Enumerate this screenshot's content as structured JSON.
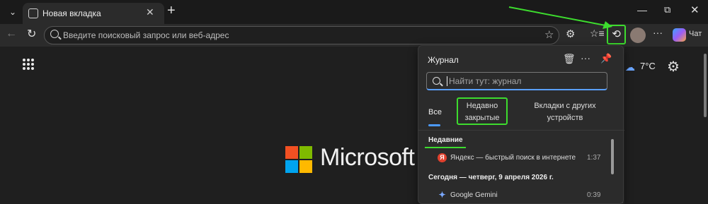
{
  "browser": {
    "tab": {
      "title": "Новая вкладка",
      "close": "✕"
    },
    "new_tab": "+",
    "window": {
      "minimize": "—",
      "maximize": "⧉",
      "close": "✕"
    },
    "tab_menu": "⌄"
  },
  "toolbar": {
    "back": "←",
    "reload": "↻",
    "omnibox_placeholder": "Введите поисковый запрос или веб-адрес",
    "star": "☆",
    "extensions": "⚙",
    "favorites": "☆≡",
    "history": "⟲",
    "more": "···",
    "chat_label": "Чат"
  },
  "page": {
    "brand_text": "Microsoft",
    "weather": {
      "icon": "☁",
      "temp": "7°C"
    },
    "settings": "⚙"
  },
  "history_panel": {
    "title": "Журнал",
    "trash": "🗑",
    "more": "···",
    "pin": "📌",
    "search_placeholder": "Найти тут: журнал",
    "tabs": [
      {
        "label": "Все"
      },
      {
        "label": "Недавно закрытые"
      },
      {
        "label": "Вкладки с других устройств"
      }
    ],
    "section_recent": "Недавние",
    "recent_items": [
      {
        "icon": "Я",
        "title": "Яндекс — быстрый поиск в интернете",
        "time": "1:37"
      }
    ],
    "section_today": "Сегодня — четверг, 9 апреля 2026 г.",
    "today_items": [
      {
        "icon": "✦",
        "title": "Google Gemini",
        "time": "0:39"
      }
    ]
  },
  "colors": {
    "highlight": "#3ddc2e",
    "accent": "#4c9aff",
    "ms_red": "#f25022",
    "ms_green": "#7fba00",
    "ms_blue": "#00a4ef",
    "ms_yellow": "#ffb900"
  }
}
